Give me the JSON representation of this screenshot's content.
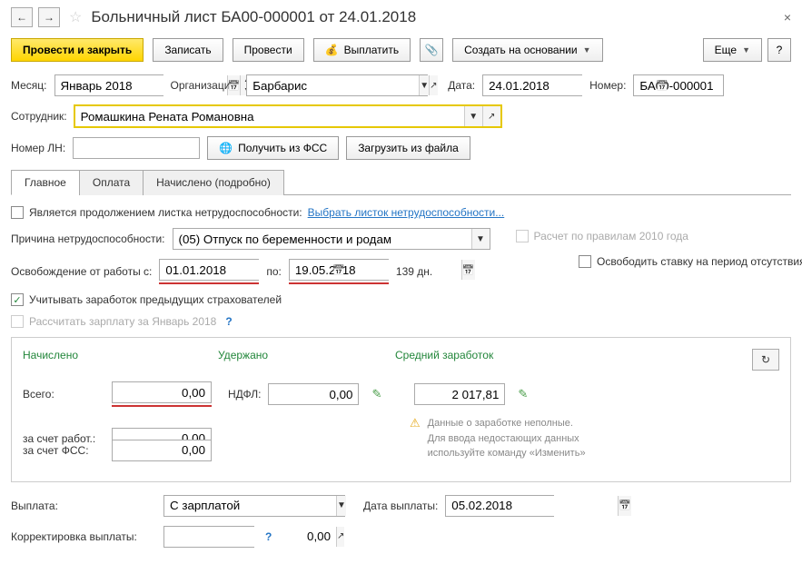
{
  "header": {
    "title": "Больничный лист БА00-000001 от 24.01.2018"
  },
  "toolbar": {
    "post_close": "Провести и закрыть",
    "save": "Записать",
    "post": "Провести",
    "pay": "Выплатить",
    "create_based": "Создать на основании",
    "more": "Еще",
    "help": "?"
  },
  "fields": {
    "month_label": "Месяц:",
    "month_value": "Январь 2018",
    "org_label": "Организация:",
    "org_value": "Барбарис",
    "date_label": "Дата:",
    "date_value": "24.01.2018",
    "number_label": "Номер:",
    "number_value": "БА00-000001",
    "employee_label": "Сотрудник:",
    "employee_value": "Ромашкина Рената Романовна",
    "ln_label": "Номер ЛН:",
    "ln_value": "",
    "get_fss": "Получить из ФСС",
    "load_file": "Загрузить из файла"
  },
  "tabs": {
    "main": "Главное",
    "payment": "Оплата",
    "accrued_detail": "Начислено (подробно)"
  },
  "main": {
    "is_continuation": "Является продолжением листка нетрудоспособности:",
    "select_sheet": "Выбрать листок нетрудоспособности...",
    "reason_label": "Причина нетрудоспособности:",
    "reason_value": "(05) Отпуск по беременности и родам",
    "rules_2010": "Расчет по правилам 2010 года",
    "release_position": "Освободить ставку на период отсутствия",
    "release_from_label": "Освобождение от работы с:",
    "date_from": "01.01.2018",
    "date_to_label": "по:",
    "date_to": "19.05.2018",
    "days": "139 дн.",
    "prev_insurers": "Учитывать заработок предыдущих страхователей",
    "calc_salary": "Рассчитать зарплату за Январь 2018"
  },
  "accruals": {
    "accrued_title": "Начислено",
    "withheld_title": "Удержано",
    "avg_title": "Средний заработок",
    "total_label": "Всего:",
    "total_value": "0,00",
    "ndfl_label": "НДФЛ:",
    "ndfl_value": "0,00",
    "avg_value": "2 017,81",
    "employer_label": "за счет работ.:",
    "employer_value": "0,00",
    "fss_label": "за счет ФСС:",
    "fss_value": "0,00",
    "warning_l1": "Данные о заработке неполные.",
    "warning_l2": "Для ввода недостающих данных",
    "warning_l3": "используйте команду «Изменить»"
  },
  "bottom": {
    "payout_label": "Выплата:",
    "payout_value": "С зарплатой",
    "payout_date_label": "Дата выплаты:",
    "payout_date_value": "05.02.2018",
    "correction_label": "Корректировка выплаты:",
    "correction_value": "0,00"
  }
}
